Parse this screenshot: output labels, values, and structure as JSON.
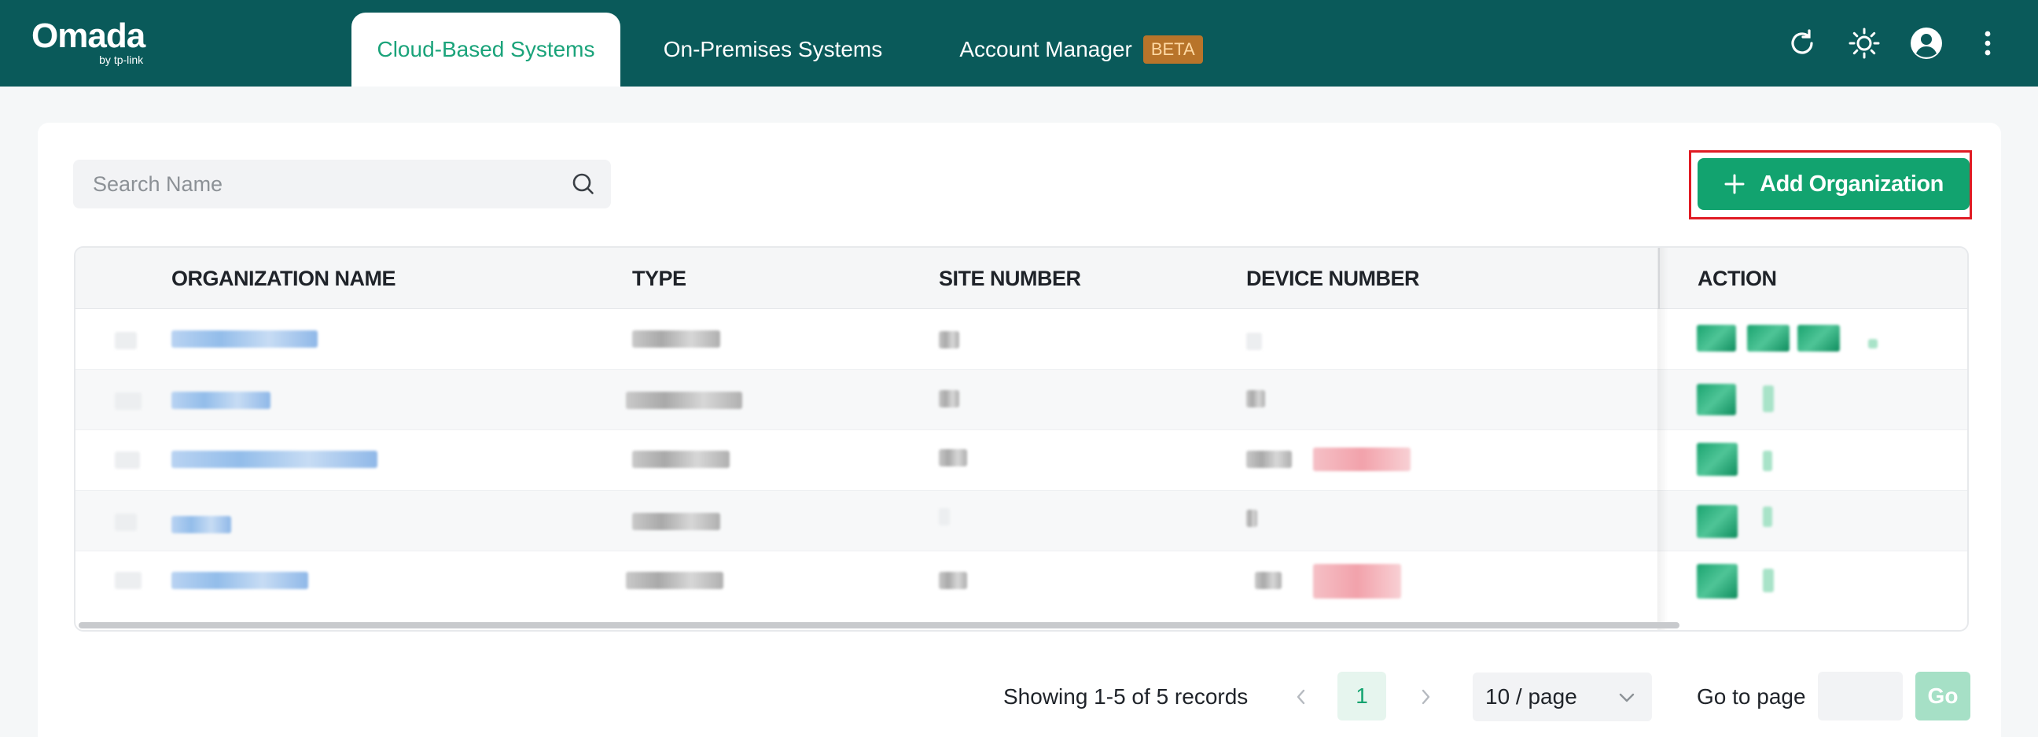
{
  "header": {
    "logo": {
      "brand": "Omada",
      "sub": "by tp-link"
    },
    "tabs": [
      {
        "label": "Cloud-Based Systems",
        "active": true
      },
      {
        "label": "On-Premises Systems",
        "active": false
      },
      {
        "label": "Account Manager",
        "badge": "BETA",
        "active": false
      }
    ],
    "icons": [
      "refresh-icon",
      "theme-sun-icon",
      "user-avatar-icon",
      "more-vertical-icon"
    ]
  },
  "toolbar": {
    "search_placeholder": "Search Name",
    "add_label": "Add Organization"
  },
  "table": {
    "columns": [
      "ORGANIZATION NAME",
      "TYPE",
      "SITE NUMBER",
      "DEVICE NUMBER",
      "ACTION"
    ],
    "row_count": 5
  },
  "pagination": {
    "summary": "Showing 1-5 of 5 records",
    "current_page": "1",
    "page_size": "10 / page",
    "goto_label": "Go to page",
    "go_label": "Go"
  },
  "colors": {
    "header_bg": "#0a5a5a",
    "accent": "#12a36f",
    "highlight_outline": "#e01b24",
    "beta_badge": "#b8742a"
  }
}
